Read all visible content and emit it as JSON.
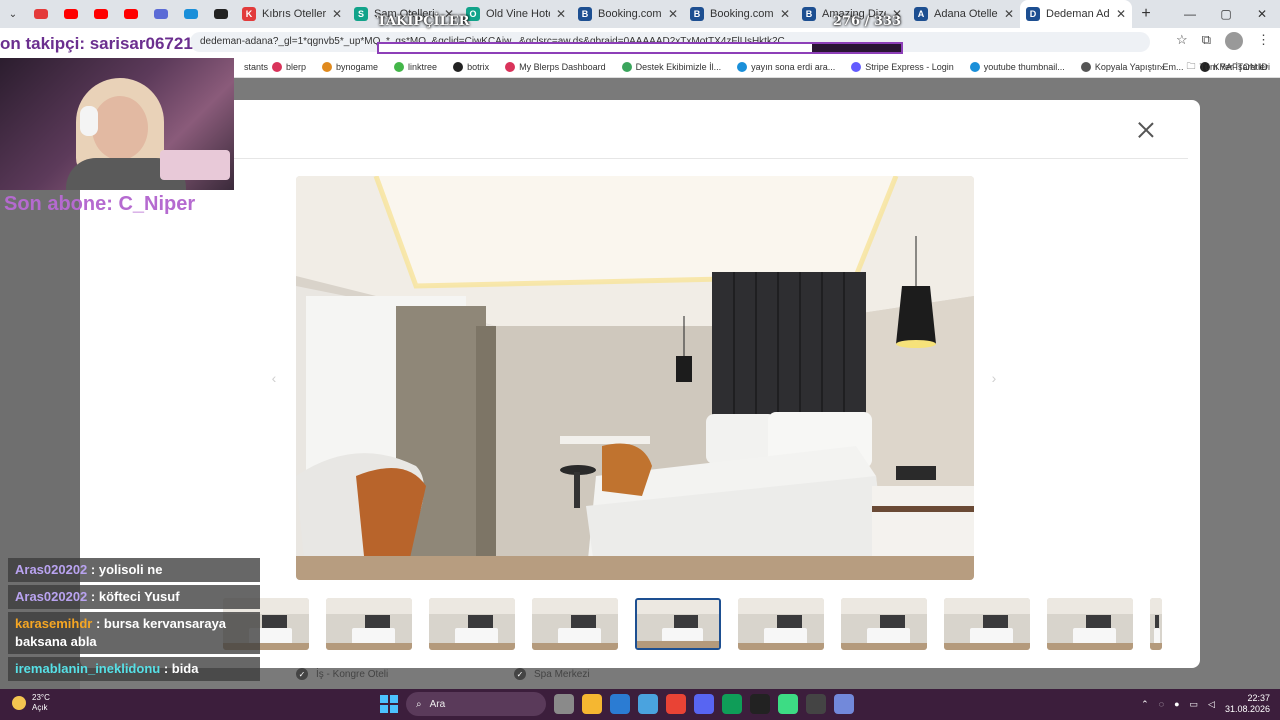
{
  "browser": {
    "tabs": [
      {
        "title": "Kıbrıs Otelleri - En",
        "color": "#e23b3b",
        "glyph": "K",
        "active": false
      },
      {
        "title": "Sam Otelleri — Konaklama",
        "color": "#12a38a",
        "glyph": "S",
        "active": false
      },
      {
        "title": "Old Vine Hotel - En",
        "color": "#12a38a",
        "glyph": "O",
        "active": false
      },
      {
        "title": "Booking.com: Hotel",
        "color": "#1d4f91",
        "glyph": "B",
        "active": false
      },
      {
        "title": "Booking.com: Hotel",
        "color": "#1d4f91",
        "glyph": "B",
        "active": false
      },
      {
        "title": "Amazing Dizengoff",
        "color": "#1d4f91",
        "glyph": "B",
        "active": false
      },
      {
        "title": "Adana Otelleri, En",
        "color": "#1d4f91",
        "glyph": "A",
        "active": false
      },
      {
        "title": "Dedeman Adana,",
        "color": "#1d4f91",
        "glyph": "D",
        "active": true
      }
    ],
    "pinned_colors": [
      "#e43a3a",
      "#ff0000",
      "#ff0000",
      "#ff0000",
      "#5b6bd6",
      "#1a8fd9",
      "#222222"
    ],
    "url": "dedeman-adana?_gl=1*qgnvb5*_up*MQ..*_gs*MQ..&gclid=CjwKCAjw...&gclsrc=aw.ds&gbraid=0AAAAAD2xTxMotTX4zFlUsHktk2C...",
    "bookmarks": [
      {
        "label": "blerp",
        "color": "#d9335a"
      },
      {
        "label": "bynogame",
        "color": "#e08a1e"
      },
      {
        "label": "linktree",
        "color": "#43b649"
      },
      {
        "label": "botrix",
        "color": "#222222"
      },
      {
        "label": "My Blerps Dashboard",
        "color": "#d9335a"
      },
      {
        "label": "Destek Ekibimizle İl...",
        "color": "#3ba55d"
      },
      {
        "label": "yayın sona erdi ara...",
        "color": "#1a8fd9"
      },
      {
        "label": "Stripe Express - Login",
        "color": "#635bff"
      },
      {
        "label": "youtube thumbnail...",
        "color": "#1a8fd9"
      },
      {
        "label": "Kopyala Yapıştır Em...",
        "color": "#555555"
      },
      {
        "label": "KRAFTON ID",
        "color": "#222222"
      }
    ],
    "bookmark_first": "stants",
    "bookmarks_all_label": "Tüm Yer İşaretleri"
  },
  "modal": {
    "thumbnail_count": 9,
    "selected_index": 3,
    "amenities": [
      {
        "label": "İş - Kongre Oteli"
      },
      {
        "label": "Spa Merkezi"
      }
    ]
  },
  "stream": {
    "follower_goal_text": "on takipçi: sarisar06721",
    "last_sub": "Son abone: C_Niper",
    "goal": {
      "title": "TAKİPÇİLER",
      "count": "276 / 333",
      "fraction": 0.829
    },
    "chat": [
      {
        "user": "Aras020202",
        "user_color": "#b9a3f0",
        "message": " : yolisoli ne"
      },
      {
        "user": "Aras020202",
        "user_color": "#b9a3f0",
        "message": " : köfteci Yusuf"
      },
      {
        "user": "karasemihdr",
        "user_color": "#f5a623",
        "message": " : bursa kervansaraya baksana abla"
      },
      {
        "user": "iremablanin_ineklidonu",
        "user_color": "#56e0e6",
        "message": " : bida"
      }
    ]
  },
  "taskbar": {
    "weather_temp": "23°C",
    "weather_desc": "Açık",
    "search_label": "Ara",
    "time": "22:37",
    "date": "31.08.2026",
    "app_colors": [
      "#8a8a8a",
      "#f5b731",
      "#2b7cd3",
      "#4aa3df",
      "#e94335",
      "#5865f2",
      "#0f9d58",
      "#222222",
      "#3ddc84",
      "#444444",
      "#7289da"
    ]
  }
}
